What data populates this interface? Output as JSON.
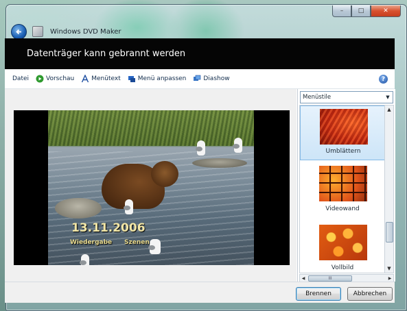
{
  "window": {
    "title": "Windows DVD Maker",
    "controls": {
      "minimize": "–",
      "maximize": "□",
      "close": "✕"
    }
  },
  "header": {
    "title": "Datenträger kann gebrannt werden"
  },
  "toolbar": {
    "items": [
      {
        "label": "Datei",
        "icon": "none"
      },
      {
        "label": "Vorschau",
        "icon": "play-icon"
      },
      {
        "label": "Menütext",
        "icon": "text-a-icon"
      },
      {
        "label": "Menü anpassen",
        "icon": "customize-icon"
      },
      {
        "label": "Diashow",
        "icon": "slideshow-icon"
      }
    ],
    "help_glyph": "?"
  },
  "preview": {
    "date": "13.11.2006",
    "play_label": "Wiedergabe",
    "scenes_label": "Szenen"
  },
  "styles_pane": {
    "dropdown_value": "Menüstile",
    "items": [
      {
        "label": "Umblättern",
        "selected": true
      },
      {
        "label": "Videowand",
        "selected": false
      },
      {
        "label": "Vollbild",
        "selected": false
      }
    ],
    "hscroll_grip": "III"
  },
  "footer": {
    "burn_label": "Brennen",
    "cancel_label": "Abbrechen"
  },
  "colors": {
    "header_bg": "#050505",
    "accent_selected": "#cde5f8",
    "primary_button_border": "#3c7fb1"
  }
}
